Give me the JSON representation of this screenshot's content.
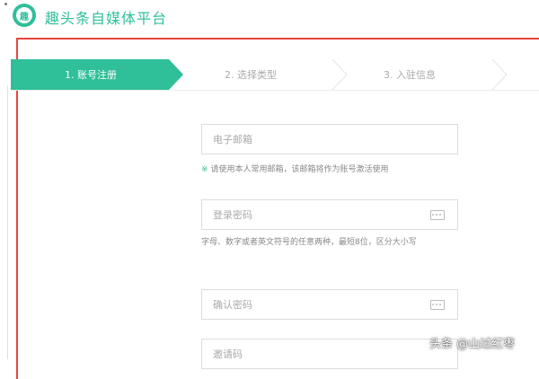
{
  "header": {
    "title": "趣头条自媒体平台",
    "logo_text": "趣"
  },
  "steps": [
    {
      "label": "1. 账号注册",
      "active": true
    },
    {
      "label": "2. 选择类型",
      "active": false
    },
    {
      "label": "3. 入驻信息",
      "active": false
    }
  ],
  "form": {
    "email_placeholder": "电子邮箱",
    "email_hint_mark": "※",
    "email_hint": "请使用本人常用邮箱，该邮箱将作为账号激活使用",
    "password_placeholder": "登录密码",
    "password_hint": "字母、数字或者英文符号的任意两种，最短8位，区分大小写",
    "confirm_placeholder": "确认密码",
    "invite_placeholder": "邀请码"
  },
  "watermark": "头条 @山过红枣",
  "colors": {
    "accent": "#2fbf99",
    "frame": "#e8443f"
  },
  "icons": {
    "logo": "qtt-logo",
    "keyboard": "keyboard-icon"
  }
}
